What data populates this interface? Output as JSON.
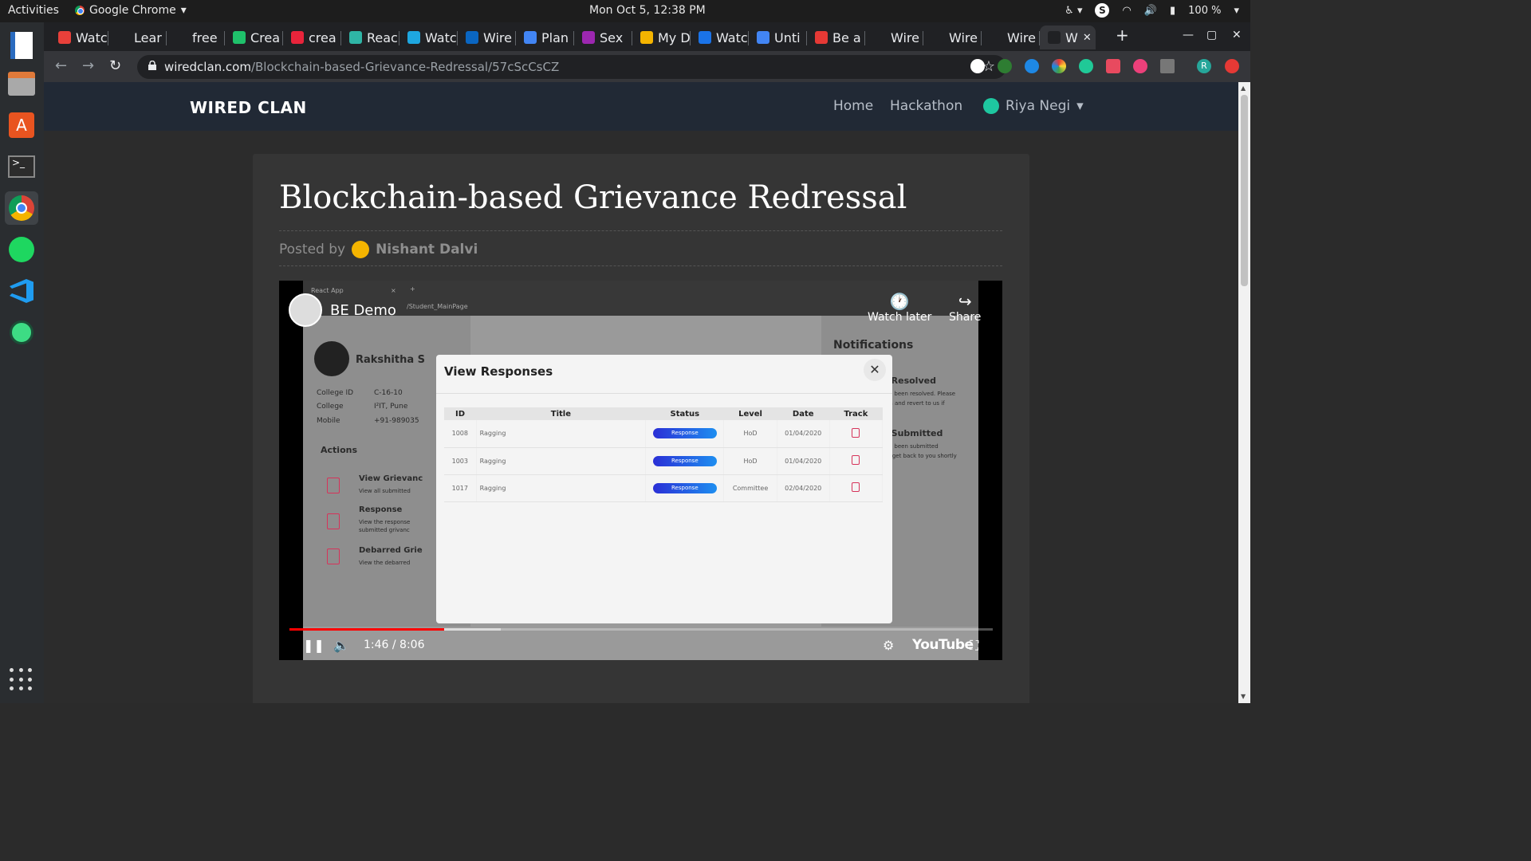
{
  "topbar": {
    "activities": "Activities",
    "app_name": "Google Chrome",
    "clock": "Mon Oct  5, 12:38 PM",
    "battery": "100 %"
  },
  "tabs": [
    {
      "label": "Watc",
      "color": "#e8403a"
    },
    {
      "label": "Lear",
      "color": "#202124"
    },
    {
      "label": "free",
      "color": "#202124"
    },
    {
      "label": "Crea",
      "color": "#1fc16b"
    },
    {
      "label": "crea",
      "color": "#e8243b"
    },
    {
      "label": "Reac",
      "color": "#2fb5a6"
    },
    {
      "label": "Watc",
      "color": "#1ea7e0"
    },
    {
      "label": "Wire",
      "color": "#0a66c2"
    },
    {
      "label": "Plan",
      "color": "#4285f4"
    },
    {
      "label": "Sex",
      "color": "#9c27b0"
    },
    {
      "label": "My D",
      "color": "#f4b400"
    },
    {
      "label": "Watc",
      "color": "#1a73e8"
    },
    {
      "label": "Unti",
      "color": "#4285f4"
    },
    {
      "label": "Be a",
      "color": "#e53935"
    },
    {
      "label": "Wire",
      "color": "#202124"
    },
    {
      "label": "Wire",
      "color": "#202124"
    },
    {
      "label": "Wire",
      "color": "#202124"
    },
    {
      "label": "W",
      "color": "#202124"
    }
  ],
  "address_bar": {
    "domain": "wiredclan.com",
    "path": "/Blockchain-based-Grievance-Redressal/57cScCsCZ"
  },
  "site": {
    "brand": "WIRED CLAN",
    "nav": [
      "Home",
      "Hackathon"
    ],
    "user": "Riya Negi"
  },
  "post": {
    "title": "Blockchain-based Grievance Redressal",
    "posted_by_label": "Posted by",
    "author": "Nishant Dalvi"
  },
  "video": {
    "channel_title": "BE Demo",
    "watch_later": "Watch later",
    "share": "Share",
    "time": "1:46 / 8:06",
    "progress_fraction": 0.22,
    "buffer_fraction": 0.3,
    "youtube": "YouTube",
    "inner": {
      "browser_tab": "React App",
      "url": "/Student_MainPage",
      "student_name": "Rakshitha S",
      "college_id_label": "College ID",
      "college_id": "C-16-10",
      "college_label": "College",
      "college": "I²IT, Pune",
      "mobile_label": "Mobile",
      "mobile": "+91-989035",
      "actions": "Actions",
      "action1_title": "View Grievanc",
      "action1_desc": "View all submitted",
      "action2_title": "Response",
      "action2_desc": "View the response",
      "action2_desc2": "submitted grivanc",
      "action3_title": "Debarred Grie",
      "action3_desc": "View the debarred",
      "notifications": "Notifications",
      "notif1_title": "nce Resolved",
      "notif1_desc": "nce has been resolved. Please",
      "notif1_desc2": "solution and revert to us if",
      "notif2_title": "nce Submitted",
      "notif2_desc": "nce has been submitted",
      "notif2_desc2": "We will get back to you shortly",
      "modal_title": "View Responses",
      "columns": [
        "ID",
        "Title",
        "Status",
        "Level",
        "Date",
        "Track"
      ],
      "rows": [
        {
          "id": "1008",
          "title": "Ragging",
          "status": "Response",
          "level": "HoD",
          "date": "01/04/2020"
        },
        {
          "id": "1003",
          "title": "Ragging",
          "status": "Response",
          "level": "HoD",
          "date": "01/04/2020"
        },
        {
          "id": "1017",
          "title": "Ragging",
          "status": "Response",
          "level": "Committee",
          "date": "02/04/2020"
        }
      ]
    }
  }
}
